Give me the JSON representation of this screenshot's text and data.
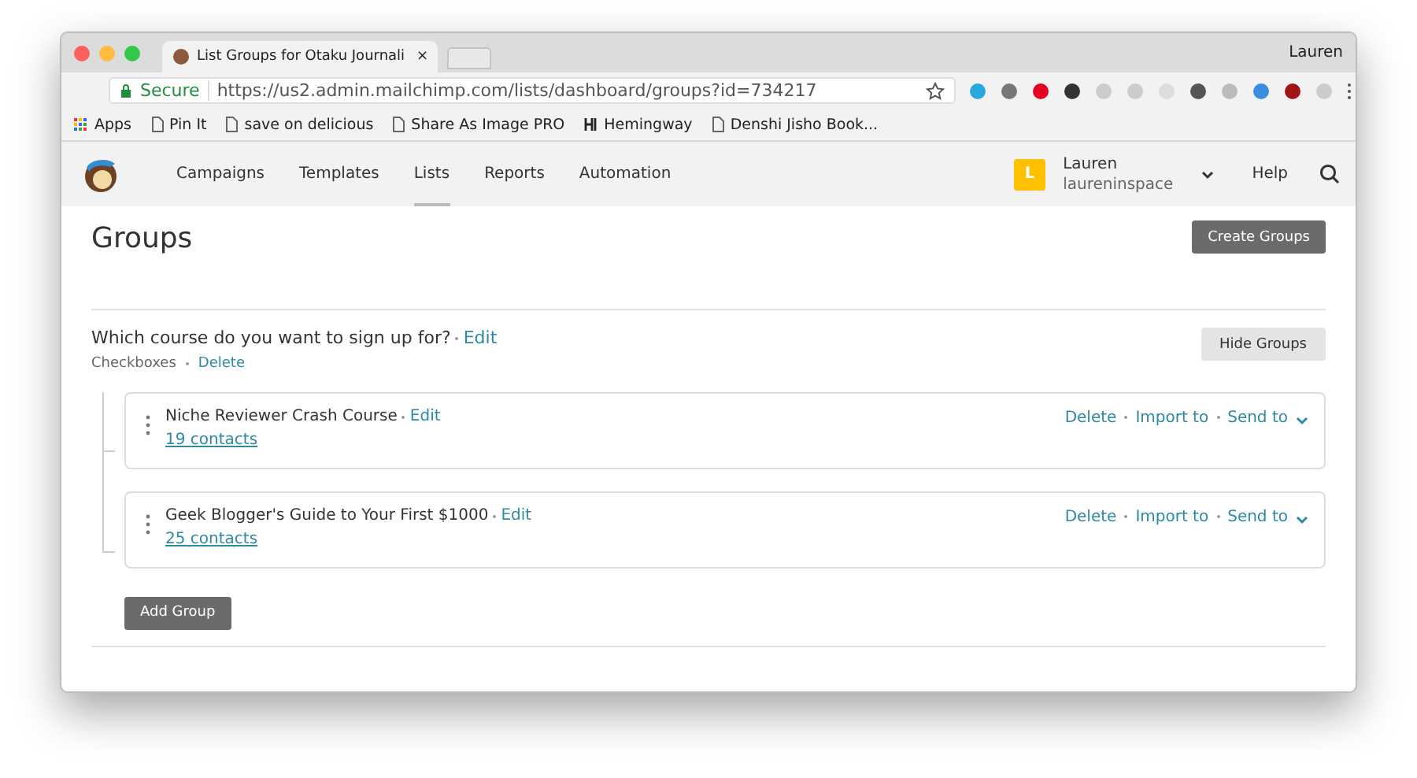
{
  "browser": {
    "tab_title": "List Groups for Otaku Journali",
    "close": "×",
    "profile": "Lauren",
    "secure_label": "Secure",
    "url": "https://us2.admin.mailchimp.com/lists/dashboard/groups?id=734217",
    "bookmarks": [
      {
        "label": "Apps",
        "kind": "apps"
      },
      {
        "label": "Pin It",
        "kind": "page"
      },
      {
        "label": "save on delicious",
        "kind": "page"
      },
      {
        "label": "Share As Image PRO",
        "kind": "page"
      },
      {
        "label": "Hemingway",
        "kind": "hemingway"
      },
      {
        "label": "Denshi Jisho Book...",
        "kind": "page"
      }
    ]
  },
  "nav": {
    "items": [
      {
        "label": "Campaigns",
        "selected": false
      },
      {
        "label": "Templates",
        "selected": false
      },
      {
        "label": "Lists",
        "selected": true
      },
      {
        "label": "Reports",
        "selected": false
      },
      {
        "label": "Automation",
        "selected": false
      }
    ],
    "avatar_letter": "L",
    "user_name": "Lauren",
    "user_handle": "laureninspace",
    "help": "Help"
  },
  "page": {
    "title": "Groups",
    "create_button": "Create Groups"
  },
  "category": {
    "question": "Which course do you want to sign up for?",
    "edit": "Edit",
    "type": "Checkboxes",
    "delete": "Delete",
    "hide_button": "Hide Groups",
    "groups": [
      {
        "name": "Niche Reviewer Crash Course",
        "edit": "Edit",
        "contacts": "19 contacts",
        "actions": [
          "Delete",
          "Import to",
          "Send to"
        ]
      },
      {
        "name": "Geek Blogger's Guide to Your First $1000",
        "edit": "Edit",
        "contacts": "25 contacts",
        "actions": [
          "Delete",
          "Import to",
          "Send to"
        ]
      }
    ],
    "add_button": "Add Group"
  }
}
